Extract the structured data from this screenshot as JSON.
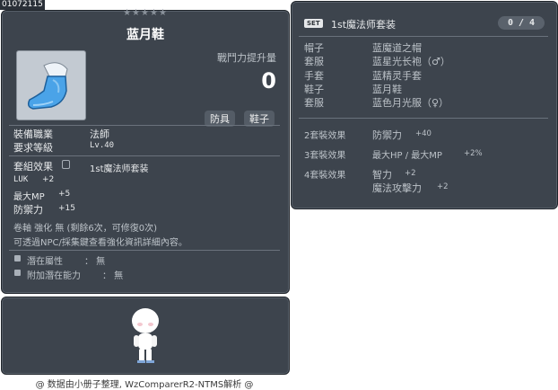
{
  "item_id": "01072115",
  "stars": "★★★★★",
  "item": {
    "name": "蓝月鞋",
    "power_label": "戰鬥力提升量",
    "power_value": "0",
    "category_tags": [
      "防具",
      "鞋子"
    ],
    "job_label": "裝備職業",
    "job_value": "法師",
    "level_label": "要求等級",
    "level_value": "Lv.40",
    "set_label": "套組效果",
    "set_name": "1st魔法师套装",
    "stats": [
      {
        "name": "LUK",
        "value": "+2"
      },
      {
        "name": "最大MP",
        "value": "+5"
      },
      {
        "name": "防禦力",
        "value": "+15"
      }
    ],
    "scroll_line": "卷軸 強化 無 (剩餘6次，可修復0次)",
    "hint_line": "可透過NPC/採集鍵查看強化資訊詳細內容。",
    "potential_label": "潛在屬性",
    "potential_value": "： 無",
    "bonus_label": "附加潛在能力",
    "bonus_value": "： 無"
  },
  "set": {
    "badge": "SET",
    "name": "1st魔法师套装",
    "count": "0 / 4",
    "pieces": [
      {
        "slot": "帽子",
        "name": "蓝魔道之帽"
      },
      {
        "slot": "套服",
        "name": "蓝星光长袍（♂）"
      },
      {
        "slot": "手套",
        "name": "蓝精灵手套"
      },
      {
        "slot": "鞋子",
        "name": "蓝月鞋"
      },
      {
        "slot": "套服",
        "name": "蓝色月光服（♀）"
      }
    ],
    "effects": [
      {
        "label": "2套裝效果",
        "lines": [
          [
            "防禦力",
            "+40"
          ]
        ]
      },
      {
        "label": "3套裝效果",
        "lines": [
          [
            "最大HP / 最大MP",
            "+2%"
          ]
        ]
      },
      {
        "label": "4套裝效果",
        "lines": [
          [
            "智力",
            "+2"
          ],
          [
            "魔法攻擊力",
            "+2"
          ]
        ]
      }
    ]
  },
  "footer": "@ 数据由小册子整理, WzComparerR2-NTMS解析 @",
  "colors": {
    "panel": "#3d444d",
    "border": "#1f242a",
    "icon_bg": "#c3cad2"
  }
}
